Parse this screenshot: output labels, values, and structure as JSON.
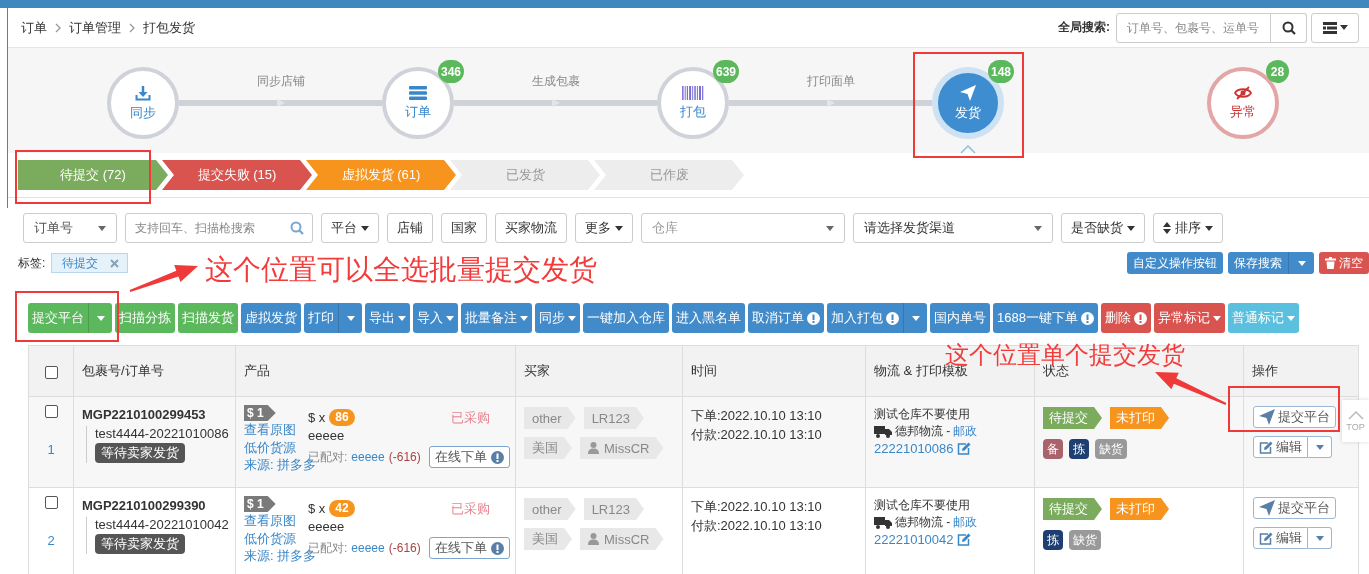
{
  "breadcrumb": [
    "订单",
    "订单管理",
    "打包发货"
  ],
  "global_search": {
    "label": "全局搜索:",
    "placeholder": "订单号、包裹号、运单号"
  },
  "workflow": {
    "steps": [
      {
        "kind": "sync",
        "label": "同步",
        "selected": false
      },
      {
        "kind": "order",
        "label": "订单",
        "badge": "346",
        "selected": false
      },
      {
        "kind": "pack",
        "label": "打包",
        "badge": "639",
        "selected": false
      },
      {
        "kind": "ship",
        "label": "发货",
        "badge": "148",
        "selected": true
      },
      {
        "kind": "exception",
        "label": "异常",
        "badge": "28",
        "selected": false
      }
    ],
    "links": [
      "同步店铺",
      "生成包裹",
      "打印面单"
    ]
  },
  "status_tabs": [
    {
      "label": "待提交 (72)",
      "color": "#7bab5d"
    },
    {
      "label": "提交失败 (15)",
      "color": "#d9534f"
    },
    {
      "label": "虚拟发货 (61)",
      "color": "#f7941d"
    },
    {
      "label": "已发货",
      "color": "#ededed"
    },
    {
      "label": "已作废",
      "color": "#ededed"
    }
  ],
  "filters": [
    {
      "kind": "select",
      "value": "订单号"
    },
    {
      "kind": "search",
      "placeholder": "支持回车、扫描枪搜索"
    },
    {
      "kind": "dropdown",
      "label": "平台"
    },
    {
      "kind": "button",
      "label": "店铺"
    },
    {
      "kind": "button",
      "label": "国家"
    },
    {
      "kind": "button",
      "label": "买家物流"
    },
    {
      "kind": "dropdown",
      "label": "更多"
    },
    {
      "kind": "select",
      "placeholder": "仓库"
    },
    {
      "kind": "select",
      "value": "请选择发货渠道"
    },
    {
      "kind": "dropdown",
      "label": "是否缺货"
    },
    {
      "kind": "sort",
      "label": "排序"
    }
  ],
  "tag_filter": {
    "label": "标签:",
    "tags": [
      "待提交"
    ]
  },
  "search_actions": [
    {
      "kind": "primary",
      "label": "自定义操作按钮"
    },
    {
      "kind": "primary",
      "label": "保存搜索",
      "split": true
    },
    {
      "kind": "danger",
      "label": "清空"
    }
  ],
  "toolbar": [
    {
      "kind": "success",
      "label": "提交平台",
      "split": true
    },
    {
      "kind": "success",
      "label": "扫描分拣"
    },
    {
      "kind": "success",
      "label": "扫描发货"
    },
    {
      "kind": "primary",
      "label": "虚拟发货"
    },
    {
      "kind": "primary",
      "label": "打印",
      "split": true
    },
    {
      "kind": "primary",
      "label": "导出",
      "caret": true
    },
    {
      "kind": "primary",
      "label": "导入",
      "caret": true
    },
    {
      "kind": "primary",
      "label": "批量备注",
      "caret": true
    },
    {
      "kind": "primary",
      "label": "同步",
      "caret": true
    },
    {
      "kind": "primary",
      "label": "一键加入仓库"
    },
    {
      "kind": "primary",
      "label": "进入黑名单"
    },
    {
      "kind": "primary",
      "label": "取消订单",
      "alert": true
    },
    {
      "kind": "primary",
      "label": "加入打包",
      "alert": true,
      "split": true
    },
    {
      "kind": "primary",
      "label": "国内单号"
    },
    {
      "kind": "primary",
      "label": "1688一键下单",
      "alert": true
    },
    {
      "kind": "danger",
      "label": "删除",
      "alert": true
    },
    {
      "kind": "danger",
      "label": "异常标记",
      "caret": true
    },
    {
      "kind": "info",
      "label": "普通标记",
      "caret": true
    }
  ],
  "table": {
    "select_all": {
      "checked": false
    },
    "columns": [
      "包裹号/订单号",
      "产品",
      "买家",
      "时间",
      "物流 & 打印模板",
      "状态",
      "操作"
    ],
    "rows": [
      {
        "checked": false,
        "index": "1",
        "package_no": "MGP2210100299453",
        "order_no": "test4444-20221010086",
        "order_status": "等待卖家发货",
        "product": {
          "price_tag": "$ 1",
          "links": [
            "查看原图",
            "低价货源",
            "来源: 拼多多"
          ],
          "qty_prefix": "$ x",
          "qty": "86",
          "name": "eeeee",
          "paired_label": "已配对:",
          "paired_name": "eeeee",
          "paired_count": "(-616)",
          "purchase_status": "已采购",
          "order_button": "在线下单"
        },
        "buyer": {
          "tags": [
            "other",
            "LR123"
          ],
          "country": "美国",
          "user": "MissCR"
        },
        "time": [
          "下单:2022.10.10 13:10",
          "付款:2022.10.10 13:10"
        ],
        "logistics": {
          "warehouse": "测试仓库不要使用",
          "carrier": "德邦物流 -",
          "channel": "邮政",
          "tracking": "22221010086"
        },
        "status_tags": [
          {
            "text": "待提交",
            "color": "#7bab5d"
          },
          {
            "text": "未打印",
            "color": "#f7941d"
          }
        ],
        "flags": [
          {
            "text": "备",
            "color": "#a9636b"
          },
          {
            "text": "拣",
            "color": "#1d3f72"
          },
          {
            "text": "缺货",
            "color": "#999999"
          }
        ],
        "actions": {
          "submit": "提交平台",
          "edit": "编辑"
        }
      },
      {
        "checked": false,
        "index": "2",
        "package_no": "MGP2210100299390",
        "order_no": "test4444-20221010042",
        "order_status": "等待卖家发货",
        "product": {
          "price_tag": "$ 1",
          "links": [
            "查看原图",
            "低价货源",
            "来源: 拼多多"
          ],
          "qty_prefix": "$ x",
          "qty": "42",
          "name": "eeeee",
          "paired_label": "已配对:",
          "paired_name": "eeeee",
          "paired_count": "(-616)",
          "purchase_status": "已采购",
          "order_button": "在线下单"
        },
        "buyer": {
          "tags": [
            "other",
            "LR123"
          ],
          "country": "美国",
          "user": "MissCR"
        },
        "time": [
          "下单:2022.10.10 13:10",
          "付款:2022.10.10 13:10"
        ],
        "logistics": {
          "warehouse": "测试仓库不要使用",
          "carrier": "德邦物流 -",
          "channel": "邮政",
          "tracking": "22221010042"
        },
        "status_tags": [
          {
            "text": "待提交",
            "color": "#7bab5d"
          },
          {
            "text": "未打印",
            "color": "#f7941d"
          }
        ],
        "flags": [
          {
            "text": "拣",
            "color": "#1d3f72"
          },
          {
            "text": "缺货",
            "color": "#999999"
          }
        ],
        "actions": {
          "submit": "提交平台",
          "edit": "编辑"
        }
      }
    ]
  },
  "back_to_top": "TOP",
  "annotations": [
    {
      "text": "这个位置可以全选批量提交发货"
    },
    {
      "text": "这个位置单个提交发货"
    }
  ]
}
